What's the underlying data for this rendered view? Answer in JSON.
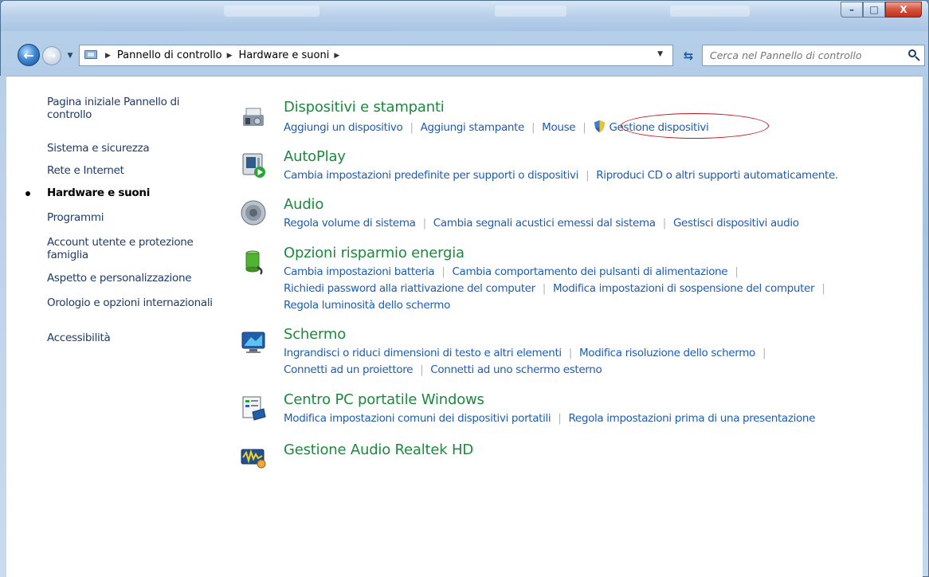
{
  "window": {
    "minimize_label": "–",
    "maximize_label": "□",
    "close_label": "X"
  },
  "address": {
    "crumbs": [
      "Pannello di controllo",
      "Hardware e suoni"
    ],
    "separator": "▶",
    "search_placeholder": "Cerca nel Pannello di controllo"
  },
  "sidebar": {
    "items": [
      {
        "label": "Pagina iniziale Pannello di controllo"
      },
      {
        "label": "Sistema e sicurezza"
      },
      {
        "label": "Rete e Internet"
      },
      {
        "label": "Hardware e suoni",
        "active": true
      },
      {
        "label": "Programmi"
      },
      {
        "label": "Account utente e protezione famiglia"
      },
      {
        "label": "Aspetto e personalizzazione"
      },
      {
        "label": "Orologio e opzioni internazionali"
      },
      {
        "label": "Accessibilità"
      }
    ]
  },
  "groups": {
    "devices": {
      "title": "Dispositivi e stampanti",
      "links": [
        "Aggiungi un dispositivo",
        "Aggiungi stampante",
        "Mouse",
        "Gestione dispositivi"
      ]
    },
    "autoplay": {
      "title": "AutoPlay",
      "links": [
        "Cambia impostazioni predefinite per supporti o dispositivi",
        "Riproduci CD o altri supporti automaticamente."
      ]
    },
    "audio": {
      "title": "Audio",
      "links": [
        "Regola volume di sistema",
        "Cambia segnali acustici emessi dal sistema",
        "Gestisci dispositivi audio"
      ]
    },
    "power": {
      "title": "Opzioni risparmio energia",
      "links": [
        "Cambia impostazioni batteria",
        "Cambia comportamento dei pulsanti di alimentazione",
        "Richiedi password alla riattivazione del computer",
        "Modifica impostazioni di sospensione del computer",
        "Regola luminosità dello schermo"
      ]
    },
    "display": {
      "title": "Schermo",
      "links": [
        "Ingrandisci o riduci dimensioni di testo e altri elementi",
        "Modifica risoluzione dello schermo",
        "Connetti ad un proiettore",
        "Connetti ad uno schermo esterno"
      ]
    },
    "mobility": {
      "title": "Centro PC portatile Windows",
      "links": [
        "Modifica impostazioni comuni dei dispositivi portatili",
        "Regola impostazioni prima di una presentazione"
      ]
    },
    "realtek": {
      "title": "Gestione Audio Realtek HD"
    }
  },
  "colors": {
    "link": "#1c5cb8",
    "group_title": "#1b8a3c",
    "highlight_circle": "#c2121c"
  }
}
